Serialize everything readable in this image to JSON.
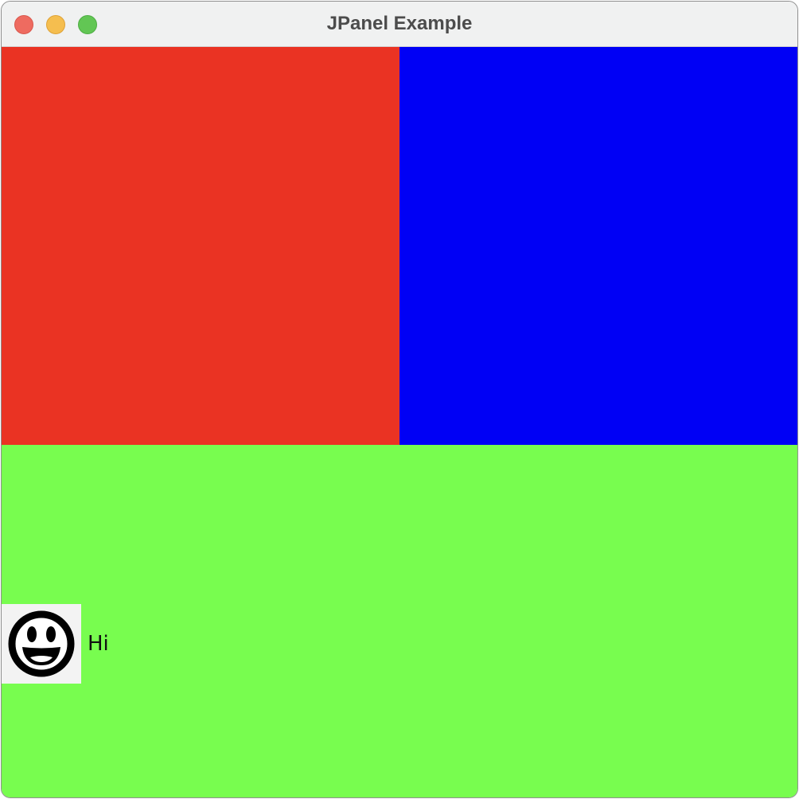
{
  "window": {
    "title": "JPanel Example",
    "buttons": [
      "close",
      "minimize",
      "maximize"
    ]
  },
  "panels": {
    "top_left": {
      "color": "#ea3323"
    },
    "top_right": {
      "color": "#0000f5"
    },
    "bottom": {
      "color": "#78fd4f"
    }
  },
  "label": {
    "text": "Hi",
    "icon": "smiley-face-icon"
  }
}
